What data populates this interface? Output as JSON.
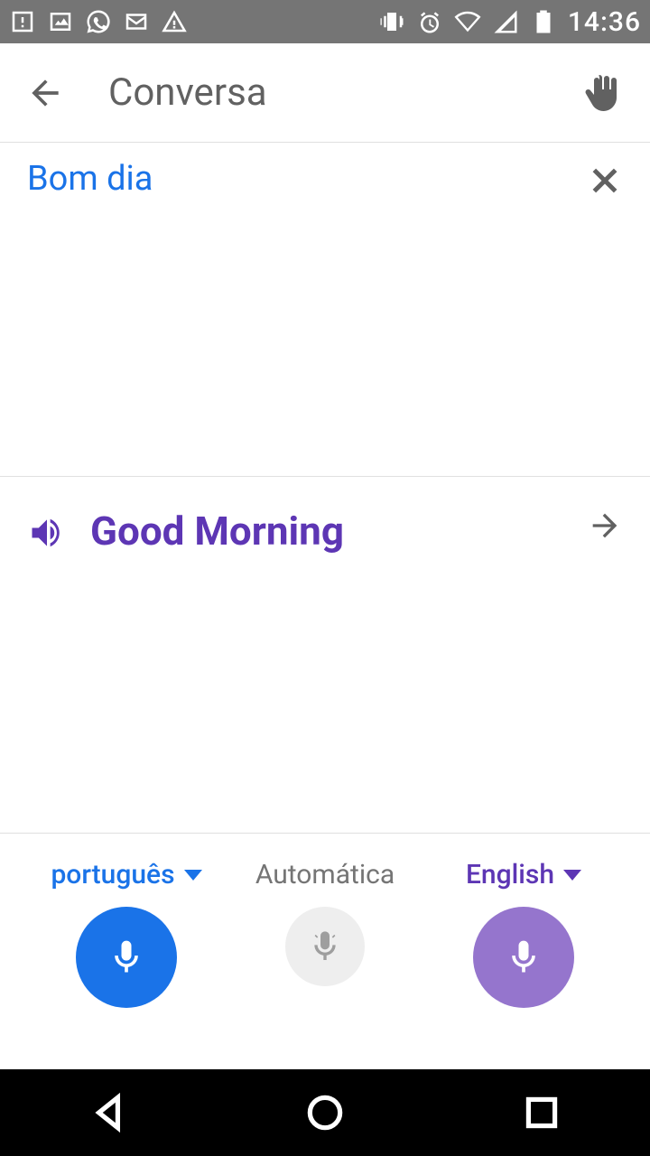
{
  "status_bar": {
    "time": "14:36"
  },
  "header": {
    "title": "Conversa"
  },
  "source": {
    "text": "Bom dia"
  },
  "translation": {
    "text": "Good Morning"
  },
  "lang_bar": {
    "source_lang": "português",
    "auto_label": "Automática",
    "target_lang": "English"
  }
}
